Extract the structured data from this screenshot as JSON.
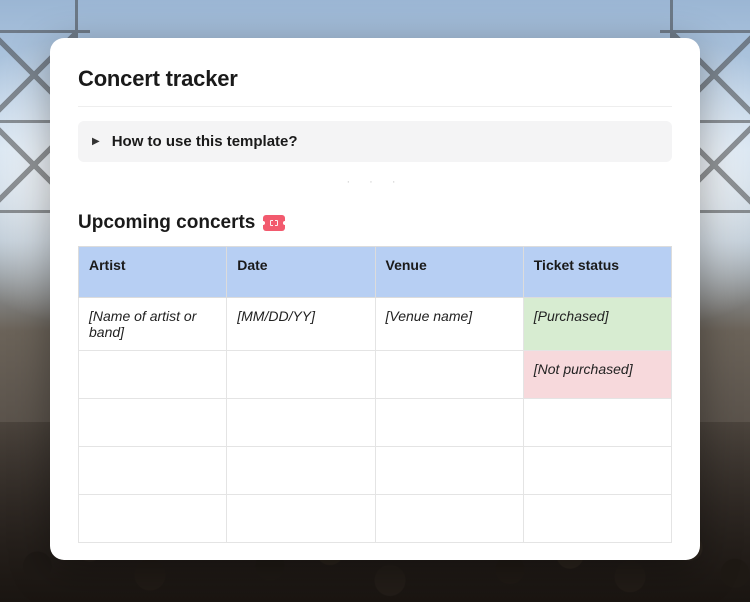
{
  "title": "Concert tracker",
  "toggle": {
    "label": "How to use this template?"
  },
  "divider": "·  ·  ·",
  "section": {
    "heading": "Upcoming concerts",
    "icon": "ticket-icon"
  },
  "table": {
    "headers": {
      "artist": "Artist",
      "date": "Date",
      "venue": "Venue",
      "status": "Ticket status"
    },
    "rows": [
      {
        "artist": "[Name of artist or band]",
        "date": "[MM/DD/YY]",
        "venue": "[Venue name]",
        "status": "[Purchased]",
        "status_kind": "purchased"
      },
      {
        "artist": "",
        "date": "",
        "venue": "",
        "status": "[Not purchased]",
        "status_kind": "notpurchased"
      },
      {
        "artist": "",
        "date": "",
        "venue": "",
        "status": "",
        "status_kind": ""
      },
      {
        "artist": "",
        "date": "",
        "venue": "",
        "status": "",
        "status_kind": ""
      },
      {
        "artist": "",
        "date": "",
        "venue": "",
        "status": "",
        "status_kind": ""
      }
    ]
  }
}
